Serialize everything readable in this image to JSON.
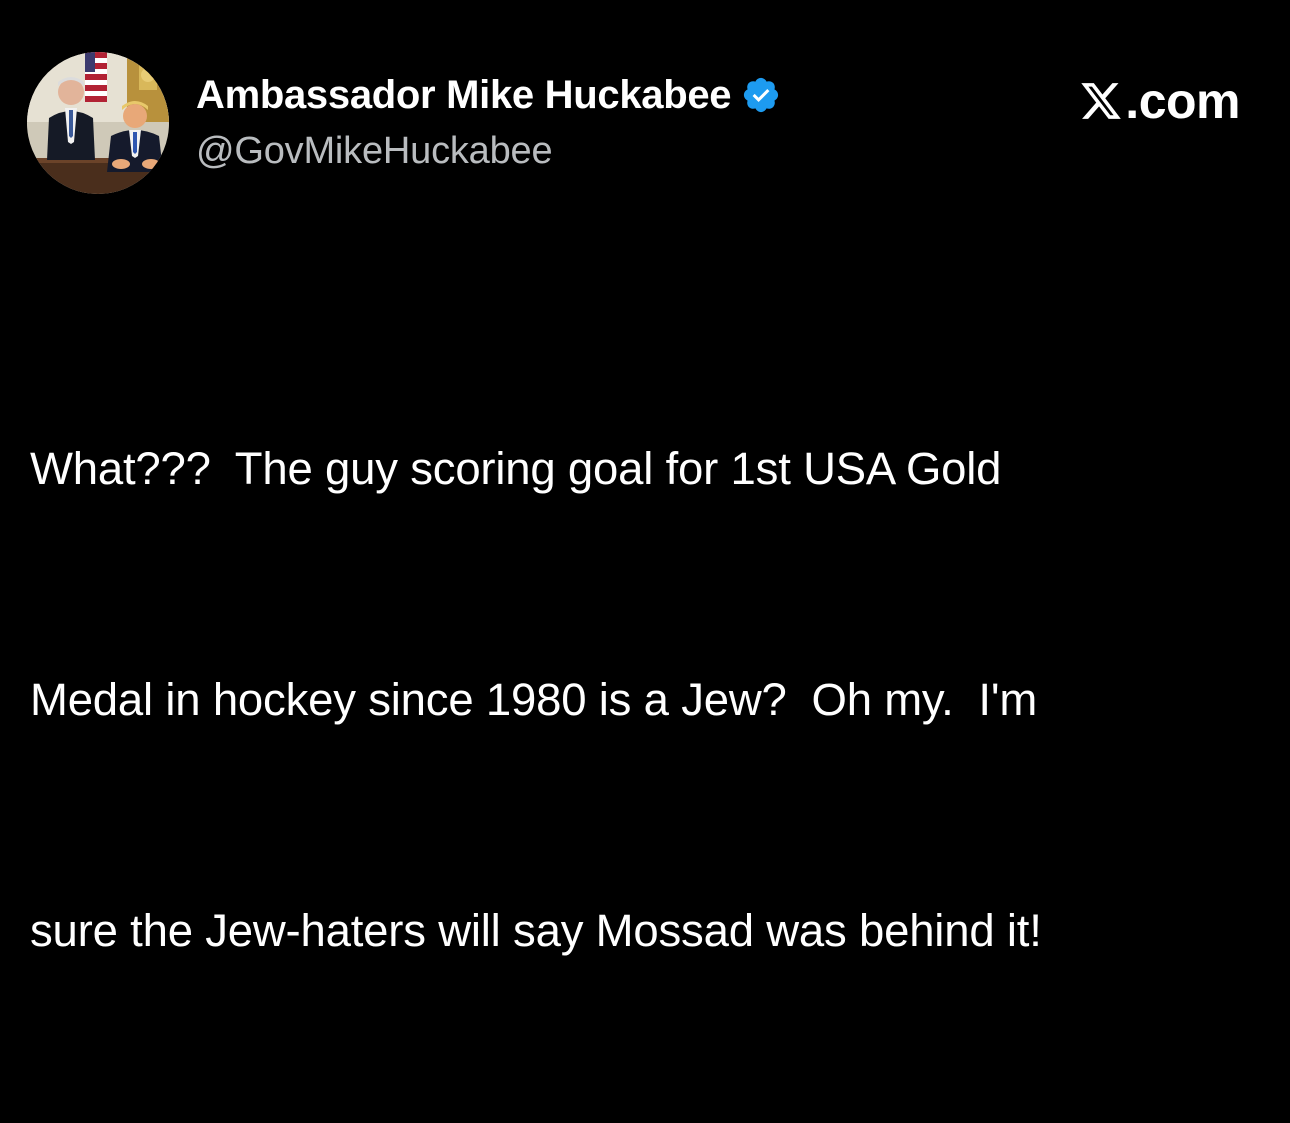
{
  "author": {
    "display_name": "Ambassador Mike Huckabee",
    "handle": "@GovMikeHuckabee",
    "verified_icon": "verified-badge-icon",
    "verified_color": "#1d9bf0"
  },
  "brand": {
    "icon": "x-logo-icon",
    "domain": "X.com",
    "domain_suffix": ".com"
  },
  "tweet": {
    "lines": [
      "What???  The guy scoring goal for 1st USA Gold",
      "Medal in hockey since 1980 is a Jew?  Oh my.  I'm",
      "sure the Jew-haters will say Mossad was behind it!"
    ]
  },
  "colors": {
    "background": "#000000",
    "text": "#ffffff",
    "handle": "#b9bcbf"
  }
}
